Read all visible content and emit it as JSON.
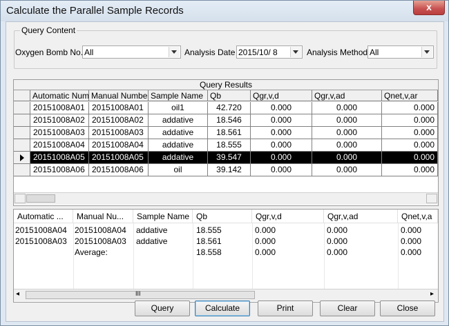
{
  "window": {
    "title": "Calculate the Parallel Sample Records",
    "close_glyph": "x"
  },
  "query_content": {
    "group_label": "Query Content",
    "oxygen_bomb_label": "Oxygen Bomb No.",
    "oxygen_bomb_value": "All",
    "analysis_date_label": "Analysis Date",
    "analysis_date_value": "2015/10/  8",
    "analysis_method_label": "Analysis Method",
    "analysis_method_value": "All"
  },
  "results": {
    "caption": "Query Results",
    "columns": [
      "Automatic Numb",
      "Manual Number",
      "Sample Name",
      "Qb",
      "Qgr,v,d",
      "Qgr,v,ad",
      "Qnet,v,ar"
    ],
    "rows": [
      [
        "20151008A01",
        "20151008A01",
        "oil1",
        "42.720",
        "0.000",
        "0.000",
        "0.000"
      ],
      [
        "20151008A02",
        "20151008A02",
        "addative",
        "18.546",
        "0.000",
        "0.000",
        "0.000"
      ],
      [
        "20151008A03",
        "20151008A03",
        "addative",
        "18.561",
        "0.000",
        "0.000",
        "0.000"
      ],
      [
        "20151008A04",
        "20151008A04",
        "addative",
        "18.555",
        "0.000",
        "0.000",
        "0.000"
      ],
      [
        "20151008A05",
        "20151008A05",
        "addative",
        "39.547",
        "0.000",
        "0.000",
        "0.000"
      ],
      [
        "20151008A06",
        "20151008A06",
        "oil",
        "39.142",
        "0.000",
        "0.000",
        "0.000"
      ]
    ],
    "selected_row": 4
  },
  "parallel": {
    "columns": [
      "Automatic ...",
      "Manual Nu...",
      "Sample Name",
      "Qb",
      "Qgr,v,d",
      "Qgr,v,ad",
      "Qnet,v,a"
    ],
    "rows": [
      [
        "20151008A04",
        "20151008A04",
        "addative",
        "18.555",
        "0.000",
        "0.000",
        "0.000"
      ],
      [
        "20151008A03",
        "20151008A03",
        "addative",
        "18.561",
        "0.000",
        "0.000",
        "0.000"
      ],
      [
        "",
        "Average:",
        "",
        "18.558",
        "0.000",
        "0.000",
        "0.000"
      ]
    ],
    "scroll_grip": "III"
  },
  "buttons": {
    "query": "Query",
    "calculate": "Calculate",
    "print": "Print",
    "clear": "Clear",
    "close": "Close"
  }
}
